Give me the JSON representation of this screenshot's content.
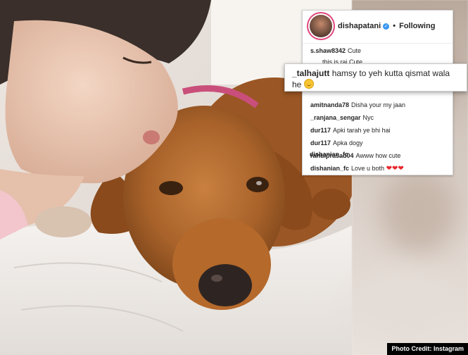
{
  "post": {
    "username": "dishapatani",
    "separator": "•",
    "follow_status": "Following"
  },
  "comments": [
    {
      "user": "s.shaw8342",
      "text": "Cute"
    },
    {
      "user": "",
      "text": "this is raj Cute..."
    },
    {
      "user": "amitnanda78",
      "text": "Disha your my jaan"
    },
    {
      "user": "_ranjana_sengar",
      "text": "Nyc"
    },
    {
      "user": "dur117",
      "text": "Apki tarah ye bhi hai"
    },
    {
      "user": "dur117",
      "text": "Apka dogy"
    },
    {
      "user": "rahulprasad04",
      "text": "Awww how cute"
    },
    {
      "user": "dishanian_fc",
      "text": "Love u both"
    },
    {
      "user": "dishanian_fc",
      "text": ""
    }
  ],
  "highlight_comment": {
    "user": "_talhajutt",
    "text": "hamsy to yeh kutta qismat wala he"
  },
  "credit": "Photo Credit: Instagram",
  "colors": {
    "verified": "#3897f0",
    "heart": "#e8262d",
    "avatar_ring": "#e0457b"
  }
}
